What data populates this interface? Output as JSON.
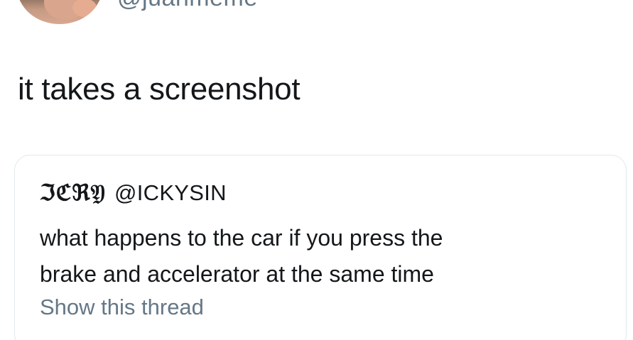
{
  "tweet": {
    "author_handle_partial": "@juanmeme",
    "text": "it takes a screenshot"
  },
  "quoted_tweet": {
    "display_name": "ℑℭℜ𝔜",
    "handle": "@ICKYSIN",
    "line1": "what happens to the car if you press the",
    "line2": "brake and accelerator at the same time",
    "show_thread_label": "Show this thread"
  }
}
